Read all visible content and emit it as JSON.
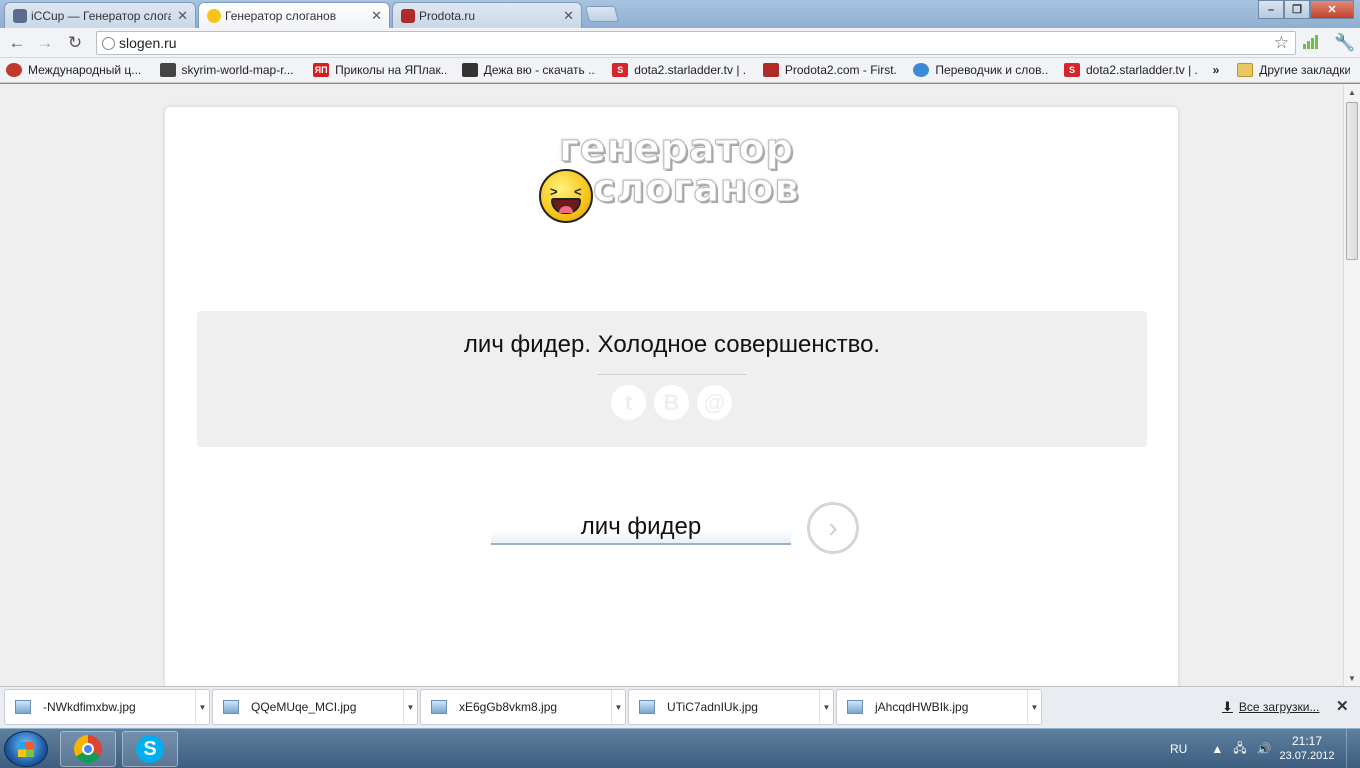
{
  "tabs": [
    {
      "title": "iCCup — Генератор слоганов"
    },
    {
      "title": "Генератор слоганов"
    },
    {
      "title": "Prodota.ru"
    }
  ],
  "address": {
    "url": "slogen.ru"
  },
  "bookmarks": [
    {
      "label": "Международный ц...",
      "icon": "opera-icon",
      "color": "#c0392b"
    },
    {
      "label": "skyrim-world-map-r...",
      "icon": "gamepad-icon",
      "color": "#444444"
    },
    {
      "label": "Приколы на ЯПлак...",
      "icon": "yap-icon",
      "color": "#d62020"
    },
    {
      "label": "Дежа вю - скачать ...",
      "icon": "film-icon",
      "color": "#333333"
    },
    {
      "label": "dota2.starladder.tv | ...",
      "icon": "starladder-icon",
      "color": "#d6262c"
    },
    {
      "label": "Prodota2.com - First...",
      "icon": "prodota-icon",
      "color": "#b02a2a"
    },
    {
      "label": "Переводчик и слов...",
      "icon": "translate-icon",
      "color": "#3a8ad4"
    },
    {
      "label": "dota2.starladder.tv | ...",
      "icon": "starladder-icon",
      "color": "#d6262c"
    }
  ],
  "bookmarks_overflow": "»",
  "other_bookmarks": "Другие закладки",
  "page": {
    "logo_line1": "генератор",
    "logo_line2": "слоганов",
    "slogan": "лич фидер. Холодное совершенство.",
    "share": [
      "t",
      "B",
      "@"
    ],
    "name_value": "лич фидер"
  },
  "downloads": [
    {
      "file": "-NWkdfimxbw.jpg"
    },
    {
      "file": "QQeMUqe_MCI.jpg"
    },
    {
      "file": "xE6gGb8vkm8.jpg"
    },
    {
      "file": "UTiC7adnIUk.jpg"
    },
    {
      "file": "jAhcqdHWBIk.jpg"
    }
  ],
  "all_downloads": "Все загрузки...",
  "taskbar": {
    "lang": "RU",
    "time": "21:17",
    "date": "23.07.2012"
  },
  "colors": {
    "accent": "#9bb0c6",
    "slogan_bg": "#efefef"
  }
}
